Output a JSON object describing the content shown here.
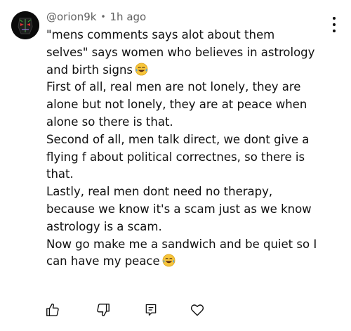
{
  "comment": {
    "author": "@orion9k",
    "separator": "•",
    "time": "1h ago",
    "lines": [
      "\"mens comments says alot about them",
      "selves\" says women who believes in astrology",
      "and birth signs",
      "First of all, real men are not lonely, they are",
      "alone but not lonely, they are at peace when",
      "alone so there is that.",
      "Second of all, men talk direct, we dont give a",
      "flying f about political correctnes, so there is",
      "that.",
      "Lastly, real men dont need no therapy,",
      "because we know it's a scam just as we know",
      "astrology is a scam.",
      "Now go make me a sandwich and be quiet so I",
      "can have my peace"
    ],
    "emoji_icon": "laughing-crying-emoji"
  },
  "actions": {
    "like_icon": "thumbs-up-icon",
    "dislike_icon": "thumbs-down-icon",
    "reply_icon": "reply-icon",
    "heart_icon": "heart-icon",
    "more_icon": "more-vertical-icon"
  },
  "colors": {
    "text": "#0f0f0f",
    "meta": "#606060",
    "background": "#ffffff"
  }
}
